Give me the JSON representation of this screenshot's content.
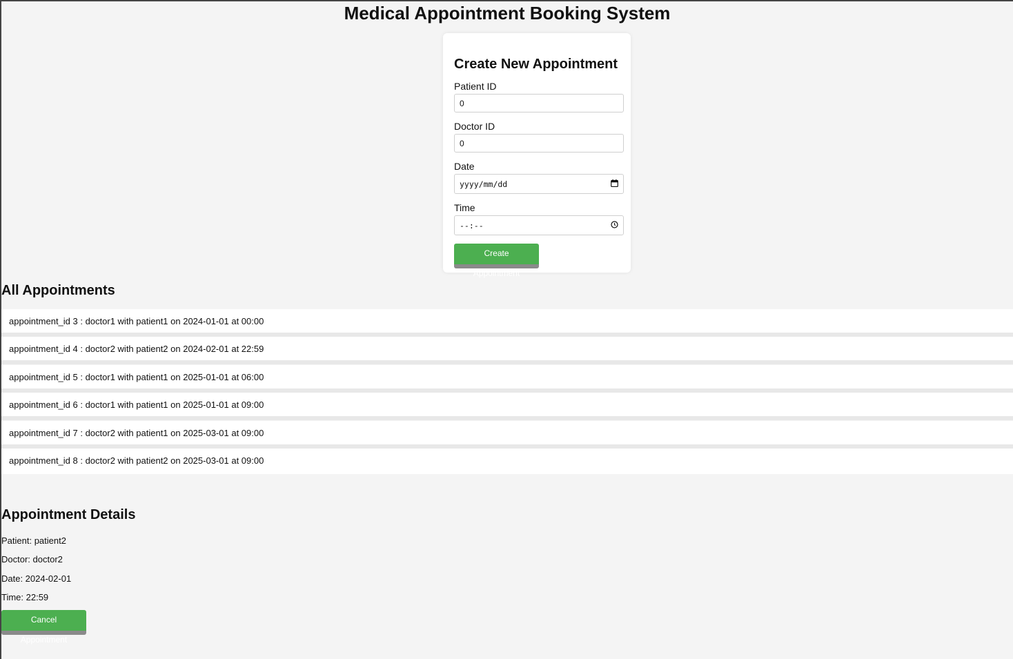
{
  "header": {
    "title": "Medical Appointment Booking System"
  },
  "form": {
    "title": "Create New Appointment",
    "patient_id": {
      "label": "Patient ID",
      "value": "0"
    },
    "doctor_id": {
      "label": "Doctor ID",
      "value": "0"
    },
    "date": {
      "label": "Date",
      "placeholder": "yyyy/mm/dd"
    },
    "time": {
      "label": "Time",
      "placeholder": "--:--"
    },
    "submit_label": "Create Appointment"
  },
  "appointments": {
    "heading": "All Appointments",
    "items": [
      "appointment_id 3 : doctor1 with patient1 on 2024-01-01 at 00:00",
      "appointment_id 4 : doctor2 with patient2 on 2024-02-01 at 22:59",
      "appointment_id 5 : doctor1 with patient1 on 2025-01-01 at 06:00",
      "appointment_id 6 : doctor1 with patient1 on 2025-01-01 at 09:00",
      "appointment_id 7 : doctor2 with patient1 on 2025-03-01 at 09:00",
      "appointment_id 8 : doctor2 with patient2 on 2025-03-01 at 09:00"
    ]
  },
  "details": {
    "heading": "Appointment Details",
    "patient": "Patient: patient2",
    "doctor": "Doctor: doctor2",
    "date": "Date: 2024-02-01",
    "time": "Time: 22:59",
    "cancel_label": "Cancel Appointment"
  },
  "colors": {
    "button_green": "#4caf50",
    "background": "#f4f4f4"
  },
  "icons": {
    "date": "calendar-icon",
    "time": "clock-icon"
  }
}
